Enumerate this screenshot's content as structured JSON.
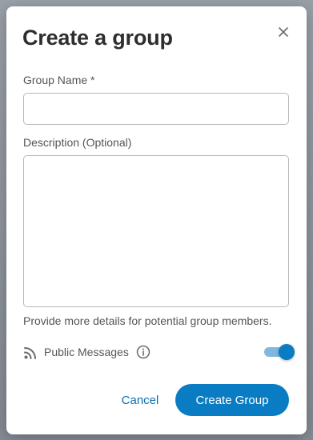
{
  "dialog": {
    "title": "Create a group",
    "close_icon": "close-icon",
    "group_name": {
      "label": "Group Name *",
      "value": "",
      "placeholder": ""
    },
    "description": {
      "label": "Description (Optional)",
      "value": "",
      "placeholder": "",
      "helper": "Provide more details for potential group members."
    },
    "public_messages": {
      "icon": "rss-icon",
      "label": "Public Messages",
      "info_icon": "info-icon",
      "enabled": true
    },
    "buttons": {
      "cancel": "Cancel",
      "create": "Create Group"
    }
  },
  "colors": {
    "accent": "#0a7cc4",
    "toggle_track": "#7fb7df",
    "title": "#2e2e2e",
    "text_secondary": "#555555"
  }
}
